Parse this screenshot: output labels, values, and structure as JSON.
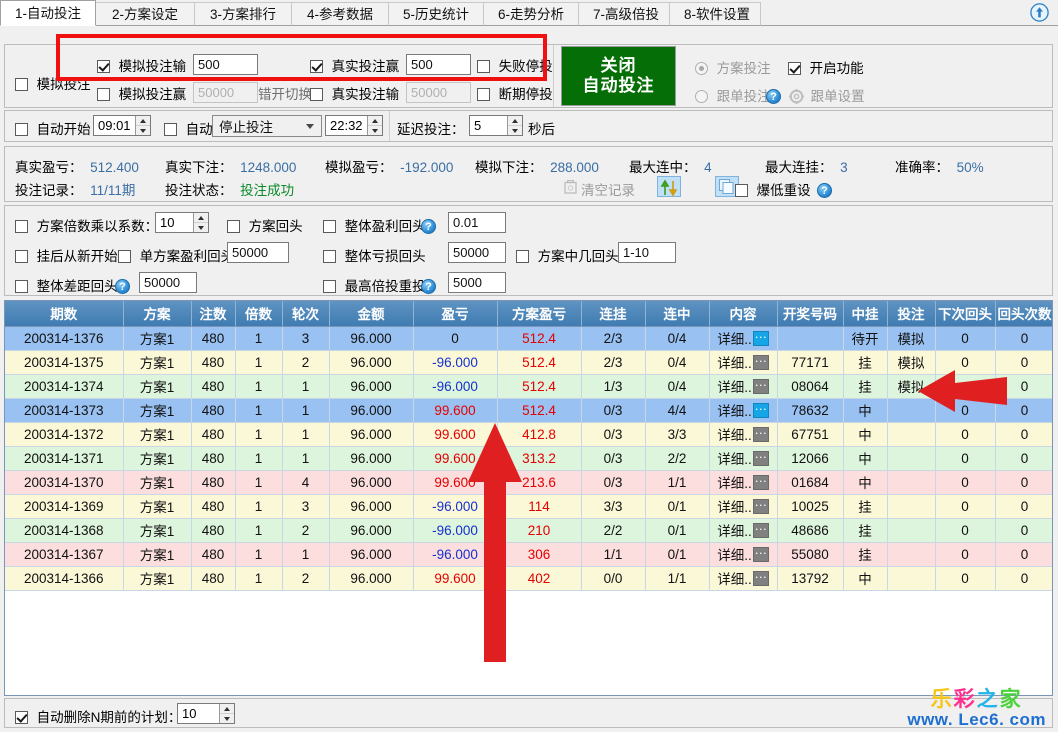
{
  "tabs": [
    {
      "label": "1-自动投注",
      "active": true
    },
    {
      "label": "2-方案设定",
      "active": false
    },
    {
      "label": "3-方案排行",
      "active": false
    },
    {
      "label": "4-参考数据",
      "active": false
    },
    {
      "label": "5-历史统计",
      "active": false
    },
    {
      "label": "6-走势分析",
      "active": false
    },
    {
      "label": "7-高级倍投",
      "active": false
    },
    {
      "label": "8-软件设置",
      "active": false
    }
  ],
  "top_panel": {
    "sim_bet_label": "模拟投注",
    "sim_bet_checked": false,
    "sim_lose_label": "模拟投注输",
    "sim_lose_checked": true,
    "sim_lose_value": "500",
    "sim_win_label": "模拟投注赢",
    "sim_win_checked": false,
    "sim_win_value": "50000",
    "stagger_label": "错开切换",
    "real_win_label": "真实投注赢",
    "real_win_checked": true,
    "real_win_value": "500",
    "real_lose_label": "真实投注输",
    "real_lose_checked": false,
    "real_lose_value": "50000",
    "fail_stop_label": "失败停投",
    "fail_stop_checked": false,
    "break_stop_label": "断期停投",
    "break_stop_checked": false,
    "main_button_line1": "关闭",
    "main_button_line2": "自动投注",
    "mode_plan_label": "方案投注",
    "mode_plan_selected": true,
    "mode_follow_label": "跟单投注",
    "mode_follow_selected": false,
    "enable_label": "开启功能",
    "enable_checked": true,
    "follow_settings_label": "跟单设置",
    "help_icon": "question-icon",
    "gear_icon": "gear-icon"
  },
  "time_panel": {
    "auto_start_label": "自动开始",
    "auto_start_checked": false,
    "start_time": "09:01",
    "auto_label": "自动",
    "auto_checked": false,
    "action_selected": "停止投注",
    "action_options": [
      "停止投注"
    ],
    "end_time": "22:32",
    "delay_label": "延迟投注：",
    "delay_value": "5",
    "delay_suffix": "秒后"
  },
  "stats": {
    "row1": [
      {
        "key": "真实盈亏：",
        "value": "512.400"
      },
      {
        "key": "真实下注：",
        "value": "1248.000"
      },
      {
        "key": "模拟盈亏：",
        "value": "-192.000"
      },
      {
        "key": "模拟下注：",
        "value": "288.000"
      },
      {
        "key": "最大连中：",
        "value": "4"
      },
      {
        "key": "最大连挂：",
        "value": "3"
      },
      {
        "key": "准确率：",
        "value": "50%"
      }
    ],
    "row2": [
      {
        "key": "投注记录：",
        "value": "11/11期"
      },
      {
        "key": "投注状态：",
        "value": "投注成功"
      }
    ],
    "clear_records_label": "清空记录",
    "reset_low_label": "爆低重设",
    "reset_low_checked": false,
    "sort_icon": "sort-arrows-icon",
    "copy_icon": "copy-icon",
    "clear_icon": "trash-icon",
    "help_icon": "question-icon"
  },
  "options": {
    "multiplier_label": "方案倍数乘以系数：",
    "multiplier_checked": false,
    "multiplier_value": "10",
    "plan_return_label": "方案回头",
    "plan_return_checked": false,
    "overall_profit_label": "整体盈利回头",
    "overall_profit_checked": false,
    "overall_profit_value": "0.01",
    "restart_after_label": "挂后从新开始",
    "restart_after_checked": false,
    "single_profit_label": "单方案盈利回头",
    "single_profit_checked": false,
    "single_profit_value": "50000",
    "overall_loss_label": "整体亏损回头",
    "overall_loss_checked": false,
    "overall_loss_value": "50000",
    "plan_hit_label": "方案中几回头",
    "plan_hit_checked": false,
    "plan_hit_value": "1-10",
    "gap_return_label": "整体差距回头",
    "gap_return_checked": false,
    "gap_return_value": "50000",
    "max_multiply_label": "最高倍投重投",
    "max_multiply_checked": false,
    "max_multiply_value": "5000"
  },
  "table": {
    "columns": [
      "期数",
      "方案",
      "注数",
      "倍数",
      "轮次",
      "金额",
      "盈亏",
      "方案盈亏",
      "连挂",
      "连中",
      "内容",
      "开奖号码",
      "中挂",
      "投注",
      "下次回头",
      "回头次数"
    ],
    "rows": [
      {
        "period": "200314-1376",
        "plan": "方案1",
        "bets": "480",
        "multi": "1",
        "round": "3",
        "amount": "96.000",
        "pl": "0",
        "pl_color": "dark",
        "plan_pl": "512.4",
        "lose_streak": "2/3",
        "win_streak": "0/4",
        "detail": "详细..",
        "detail_btn": "blue",
        "draw": "",
        "hit": "待开",
        "bet_type": "模拟",
        "next_return": "0",
        "return_count": "0",
        "rowclass": "rb-blue"
      },
      {
        "period": "200314-1375",
        "plan": "方案1",
        "bets": "480",
        "multi": "1",
        "round": "2",
        "amount": "96.000",
        "pl": "-96.000",
        "pl_color": "blue",
        "plan_pl": "512.4",
        "lose_streak": "2/3",
        "win_streak": "0/4",
        "detail": "详细..",
        "detail_btn": "gray",
        "draw": "77171",
        "hit": "挂",
        "bet_type": "模拟",
        "next_return": "0",
        "return_count": "0",
        "rowclass": "rb-cream"
      },
      {
        "period": "200314-1374",
        "plan": "方案1",
        "bets": "480",
        "multi": "1",
        "round": "1",
        "amount": "96.000",
        "pl": "-96.000",
        "pl_color": "blue",
        "plan_pl": "512.4",
        "lose_streak": "1/3",
        "win_streak": "0/4",
        "detail": "详细..",
        "detail_btn": "gray",
        "draw": "08064",
        "hit": "挂",
        "bet_type": "模拟",
        "next_return": "",
        "return_count": "0",
        "rowclass": "rb-green"
      },
      {
        "period": "200314-1373",
        "plan": "方案1",
        "bets": "480",
        "multi": "1",
        "round": "1",
        "amount": "96.000",
        "pl": "99.600",
        "pl_color": "red",
        "plan_pl": "512.4",
        "lose_streak": "0/3",
        "win_streak": "4/4",
        "detail": "详细..",
        "detail_btn": "blue",
        "draw": "78632",
        "hit": "中",
        "bet_type": "",
        "next_return": "0",
        "return_count": "0",
        "rowclass": "rb-blue"
      },
      {
        "period": "200314-1372",
        "plan": "方案1",
        "bets": "480",
        "multi": "1",
        "round": "1",
        "amount": "96.000",
        "pl": "99.600",
        "pl_color": "red",
        "plan_pl": "412.8",
        "lose_streak": "0/3",
        "win_streak": "3/3",
        "detail": "详细..",
        "detail_btn": "gray",
        "draw": "67751",
        "hit": "中",
        "bet_type": "",
        "next_return": "0",
        "return_count": "0",
        "rowclass": "rb-cream"
      },
      {
        "period": "200314-1371",
        "plan": "方案1",
        "bets": "480",
        "multi": "1",
        "round": "1",
        "amount": "96.000",
        "pl": "99.600",
        "pl_color": "red",
        "plan_pl": "313.2",
        "lose_streak": "0/3",
        "win_streak": "2/2",
        "detail": "详细..",
        "detail_btn": "gray",
        "draw": "12066",
        "hit": "中",
        "bet_type": "",
        "next_return": "0",
        "return_count": "0",
        "rowclass": "rb-green"
      },
      {
        "period": "200314-1370",
        "plan": "方案1",
        "bets": "480",
        "multi": "1",
        "round": "4",
        "amount": "96.000",
        "pl": "99.600",
        "pl_color": "red",
        "plan_pl": "213.6",
        "lose_streak": "0/3",
        "win_streak": "1/1",
        "detail": "详细..",
        "detail_btn": "gray",
        "draw": "01684",
        "hit": "中",
        "bet_type": "",
        "next_return": "0",
        "return_count": "0",
        "rowclass": "rb-pink"
      },
      {
        "period": "200314-1369",
        "plan": "方案1",
        "bets": "480",
        "multi": "1",
        "round": "3",
        "amount": "96.000",
        "pl": "-96.000",
        "pl_color": "blue",
        "plan_pl": "114",
        "lose_streak": "3/3",
        "win_streak": "0/1",
        "detail": "详细..",
        "detail_btn": "gray",
        "draw": "10025",
        "hit": "挂",
        "bet_type": "",
        "next_return": "0",
        "return_count": "0",
        "rowclass": "rb-cream"
      },
      {
        "period": "200314-1368",
        "plan": "方案1",
        "bets": "480",
        "multi": "1",
        "round": "2",
        "amount": "96.000",
        "pl": "-96.000",
        "pl_color": "blue",
        "plan_pl": "210",
        "lose_streak": "2/2",
        "win_streak": "0/1",
        "detail": "详细..",
        "detail_btn": "gray",
        "draw": "48686",
        "hit": "挂",
        "bet_type": "",
        "next_return": "0",
        "return_count": "0",
        "rowclass": "rb-green"
      },
      {
        "period": "200314-1367",
        "plan": "方案1",
        "bets": "480",
        "multi": "1",
        "round": "1",
        "amount": "96.000",
        "pl": "-96.000",
        "pl_color": "blue",
        "plan_pl": "306",
        "lose_streak": "1/1",
        "win_streak": "0/1",
        "detail": "详细..",
        "detail_btn": "gray",
        "draw": "55080",
        "hit": "挂",
        "bet_type": "",
        "next_return": "0",
        "return_count": "0",
        "rowclass": "rb-pink"
      },
      {
        "period": "200314-1366",
        "plan": "方案1",
        "bets": "480",
        "multi": "1",
        "round": "2",
        "amount": "96.000",
        "pl": "99.600",
        "pl_color": "red",
        "plan_pl": "402",
        "lose_streak": "0/0",
        "win_streak": "1/1",
        "detail": "详细..",
        "detail_btn": "gray",
        "draw": "13792",
        "hit": "中",
        "bet_type": "",
        "next_return": "0",
        "return_count": "0",
        "rowclass": "rb-cream"
      }
    ]
  },
  "bottom": {
    "auto_delete_label": "自动删除N期前的计划：",
    "auto_delete_checked": true,
    "auto_delete_value": "10"
  },
  "logo": {
    "cn": [
      "乐",
      "彩",
      "之",
      "家"
    ],
    "url": "www. Lec6. com"
  },
  "colors": {
    "accent_green": "#056e06",
    "header_blue": "#4a84b8",
    "highlight_red": "#f01010",
    "value_blue": "#3b6ea5"
  }
}
